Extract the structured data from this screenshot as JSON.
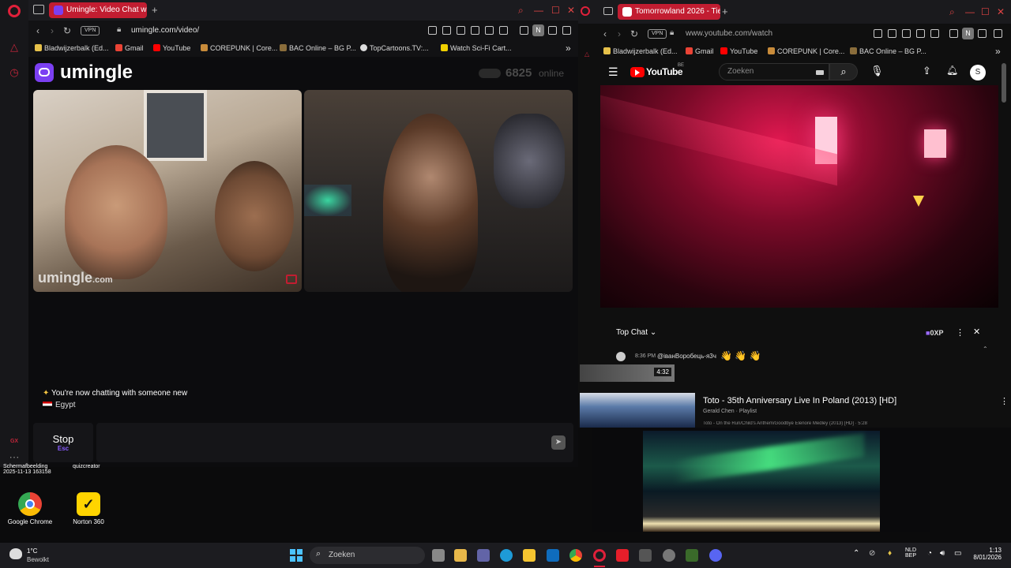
{
  "left_browser": {
    "tab_title": "Umingle: Video Chat w",
    "url": "umingle.com/video/",
    "vpn": "VPN",
    "bookmarks": [
      "Bladwijzerbalk (Ed...",
      "Gmail",
      "YouTube",
      "COREPUNK | Core...",
      "BAC Online – BG P...",
      "TopCartoons.TV:...",
      "Watch Sci-Fi Cart..."
    ],
    "profile_initial": "N"
  },
  "umingle": {
    "logo": "umingle",
    "online_count": "6825",
    "online_label": "online",
    "watermark": "umingle",
    "watermark_suffix": ".com",
    "chat_message": "You're now chatting with someone new",
    "country": "Egypt",
    "stop_label": "Stop",
    "stop_shortcut": "Esc",
    "colors": {
      "accent": "#7b3ff2",
      "tab_red": "#c21d31"
    }
  },
  "right_browser": {
    "tab_title": "Tomorrowland 2026 - Tie",
    "url": "www.youtube.com/watch",
    "vpn": "VPN",
    "bookmarks": [
      "Bladwijzerbalk (Ed...",
      "Gmail",
      "YouTube",
      "COREPUNK | Core...",
      "BAC Online – BG P..."
    ],
    "profile_initial": "N"
  },
  "youtube": {
    "logo": "YouTube",
    "region": "BE",
    "search_placeholder": "Zoeken",
    "avatar_initial": "S",
    "chat_title": "Top Chat",
    "xp": "0XP",
    "chat_time": "8:36 PM",
    "chat_user": "@іванВоробець-я3ч",
    "chat_emojis": "👋 👋 👋",
    "thumb_duration": "4:32",
    "video_title": "Toto - 35th Anniversary Live In Poland (2013) [HD]",
    "video_channel": "Gerald Chen · Playlist",
    "video_sub": "Toto - On the Run/Child's Anthem/Goodbye Elenore Medley (2013) [HD] · 5:28"
  },
  "desktop": {
    "screenshot_label": "Schermafbeelding",
    "screenshot_date": "2025-11-13 163158",
    "other_label": "quizcreator",
    "icons": [
      {
        "label": "Google Chrome"
      },
      {
        "label": "Norton 360"
      }
    ]
  },
  "taskbar": {
    "weather_temp": "1°C",
    "weather_desc": "Bewolkt",
    "search_placeholder": "Zoeken",
    "lang": "NLD",
    "lang2": "BEP",
    "time": "1:13",
    "date": "8/01/2026"
  }
}
